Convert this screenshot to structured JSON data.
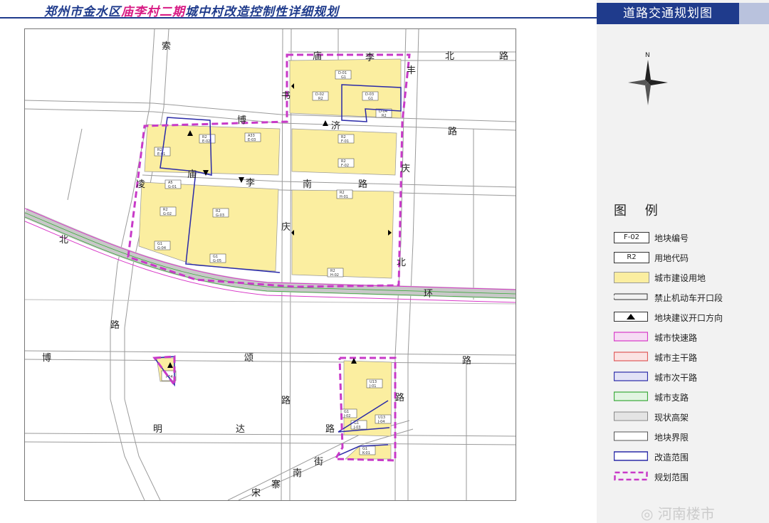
{
  "title": {
    "part1": "郑州市金水区",
    "part2": "庙李村二期",
    "part3": "城中村改造控制性详细规划"
  },
  "panel_title": "道路交通规划图",
  "compass_label": "N",
  "legend": {
    "heading": "图 例",
    "items": [
      {
        "key": "plot_number",
        "label": "地块编号",
        "sample": "F-02"
      },
      {
        "key": "land_code",
        "label": "用地代码",
        "sample": "R2"
      },
      {
        "key": "urban_land",
        "label": "城市建设用地"
      },
      {
        "key": "no_vehicle_opening",
        "label": "禁止机动车开口段"
      },
      {
        "key": "opening_direction",
        "label": "地块建议开口方向"
      },
      {
        "key": "expressway",
        "label": "城市快速路"
      },
      {
        "key": "arterial",
        "label": "城市主干路"
      },
      {
        "key": "secondary",
        "label": "城市次干路"
      },
      {
        "key": "branch",
        "label": "城市支路"
      },
      {
        "key": "elevated",
        "label": "现状高架"
      },
      {
        "key": "plot_boundary",
        "label": "地块界限"
      },
      {
        "key": "renovation_scope",
        "label": "改造范围"
      },
      {
        "key": "planning_scope",
        "label": "规划范围"
      }
    ]
  },
  "colors": {
    "title": "#1f3b8c",
    "title_highlight": "#d81b84",
    "urban_land": "#fbeea0",
    "expressway": "#d838c8",
    "arterial": "#e05a5a",
    "secondary": "#2a2aa8",
    "branch": "#3aaa3a",
    "planning_scope": "#c83ac8",
    "renovation_scope": "#2a2aa8"
  },
  "road_labels": {
    "suo_1": "索",
    "suo_2": "书",
    "miaoli_n_1": "庙",
    "miaoli_n_2": "李",
    "feng": "丰",
    "north_1": "北",
    "north_2": "路",
    "bo_1": "博",
    "bo_2": "济",
    "road_right": "路",
    "qing": "庆",
    "ling": "凌",
    "miaoli_c_1": "庙",
    "miaoli_c_2": "李",
    "miaoli_c_3": "南",
    "miaoli_c_4": "路",
    "qing_c": "庆",
    "north_c": "北",
    "beihuan_1": "北",
    "beihuan_2": "环",
    "lu_left": "路",
    "bosong_1": "博",
    "bosong_2": "颂",
    "bosong_3": "路",
    "lu_center": "路",
    "lu_right": "路",
    "mingda_1": "明",
    "mingda_2": "达",
    "mingda_3": "路",
    "jie": "街",
    "nan": "南",
    "zhai": "寨",
    "song": "宋"
  },
  "plots": [
    {
      "code": "G1",
      "id": "D-01"
    },
    {
      "code": "R2",
      "id": "D-02"
    },
    {
      "code": "G1",
      "id": "D-03"
    },
    {
      "code": "R2",
      "id": "D-04"
    },
    {
      "code": "R2",
      "id": "E-02"
    },
    {
      "code": "A33",
      "id": "E-03"
    },
    {
      "code": "R2",
      "id": "E-01"
    },
    {
      "code": "R2",
      "id": "F-01"
    },
    {
      "code": "R2",
      "id": "F-02"
    },
    {
      "code": "A5",
      "id": "G-01"
    },
    {
      "code": "R2",
      "id": "G-02"
    },
    {
      "code": "R2",
      "id": "G-03"
    },
    {
      "code": "G1",
      "id": "G-04"
    },
    {
      "code": "G1",
      "id": "G-05"
    },
    {
      "code": "R2",
      "id": "H-01"
    },
    {
      "code": "R2",
      "id": "H-02"
    },
    {
      "code": "U13",
      "id": "J-01"
    },
    {
      "code": "G1",
      "id": "J-02"
    },
    {
      "code": "G1",
      "id": "J-03"
    },
    {
      "code": "U13",
      "id": "J-04"
    },
    {
      "code": "G1",
      "id": "K-01"
    },
    {
      "code": "",
      "id": "I-04"
    }
  ],
  "watermark": "河南楼市"
}
